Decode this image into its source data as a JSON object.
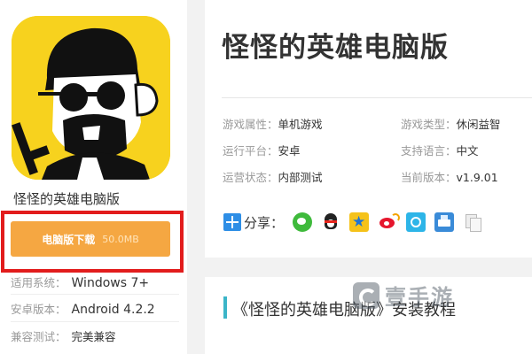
{
  "left_panel": {
    "app_name": "怪怪的英雄电脑版",
    "download_button": {
      "label": "电脑版下载",
      "size": "50.0MB"
    },
    "specs": [
      {
        "key": "适用系统：",
        "value": "Windows 7+"
      },
      {
        "key": "安卓版本：",
        "value": "Android 4.2.2"
      },
      {
        "key": "兼容测试：",
        "value": "完美兼容"
      }
    ]
  },
  "header": {
    "title": "怪怪的英雄电脑版"
  },
  "attributes": [
    {
      "key": "游戏属性：",
      "value": "单机游戏"
    },
    {
      "key": "游戏类型：",
      "value": "休闲益智"
    },
    {
      "key": "运行平台：",
      "value": "安卓"
    },
    {
      "key": "支持语言：",
      "value": "中文"
    },
    {
      "key": "运营状态：",
      "value": "内部测试"
    },
    {
      "key": "当前版本：",
      "value": "v1.9.01"
    }
  ],
  "share": {
    "label": "分享：",
    "icons": [
      "wechat-icon",
      "qq-icon",
      "qzone-icon",
      "weibo-icon",
      "tencent-weibo-icon",
      "print-icon",
      "copy-icon"
    ]
  },
  "section": {
    "heading": "《怪怪的英雄电脑版》安装教程"
  },
  "watermark": {
    "text": "壹手游"
  },
  "colors": {
    "download_button": "#f5a742",
    "highlight_frame": "#e21c1c",
    "icon_background": "#f7d21e",
    "section_accent": "#3bb5c8"
  }
}
